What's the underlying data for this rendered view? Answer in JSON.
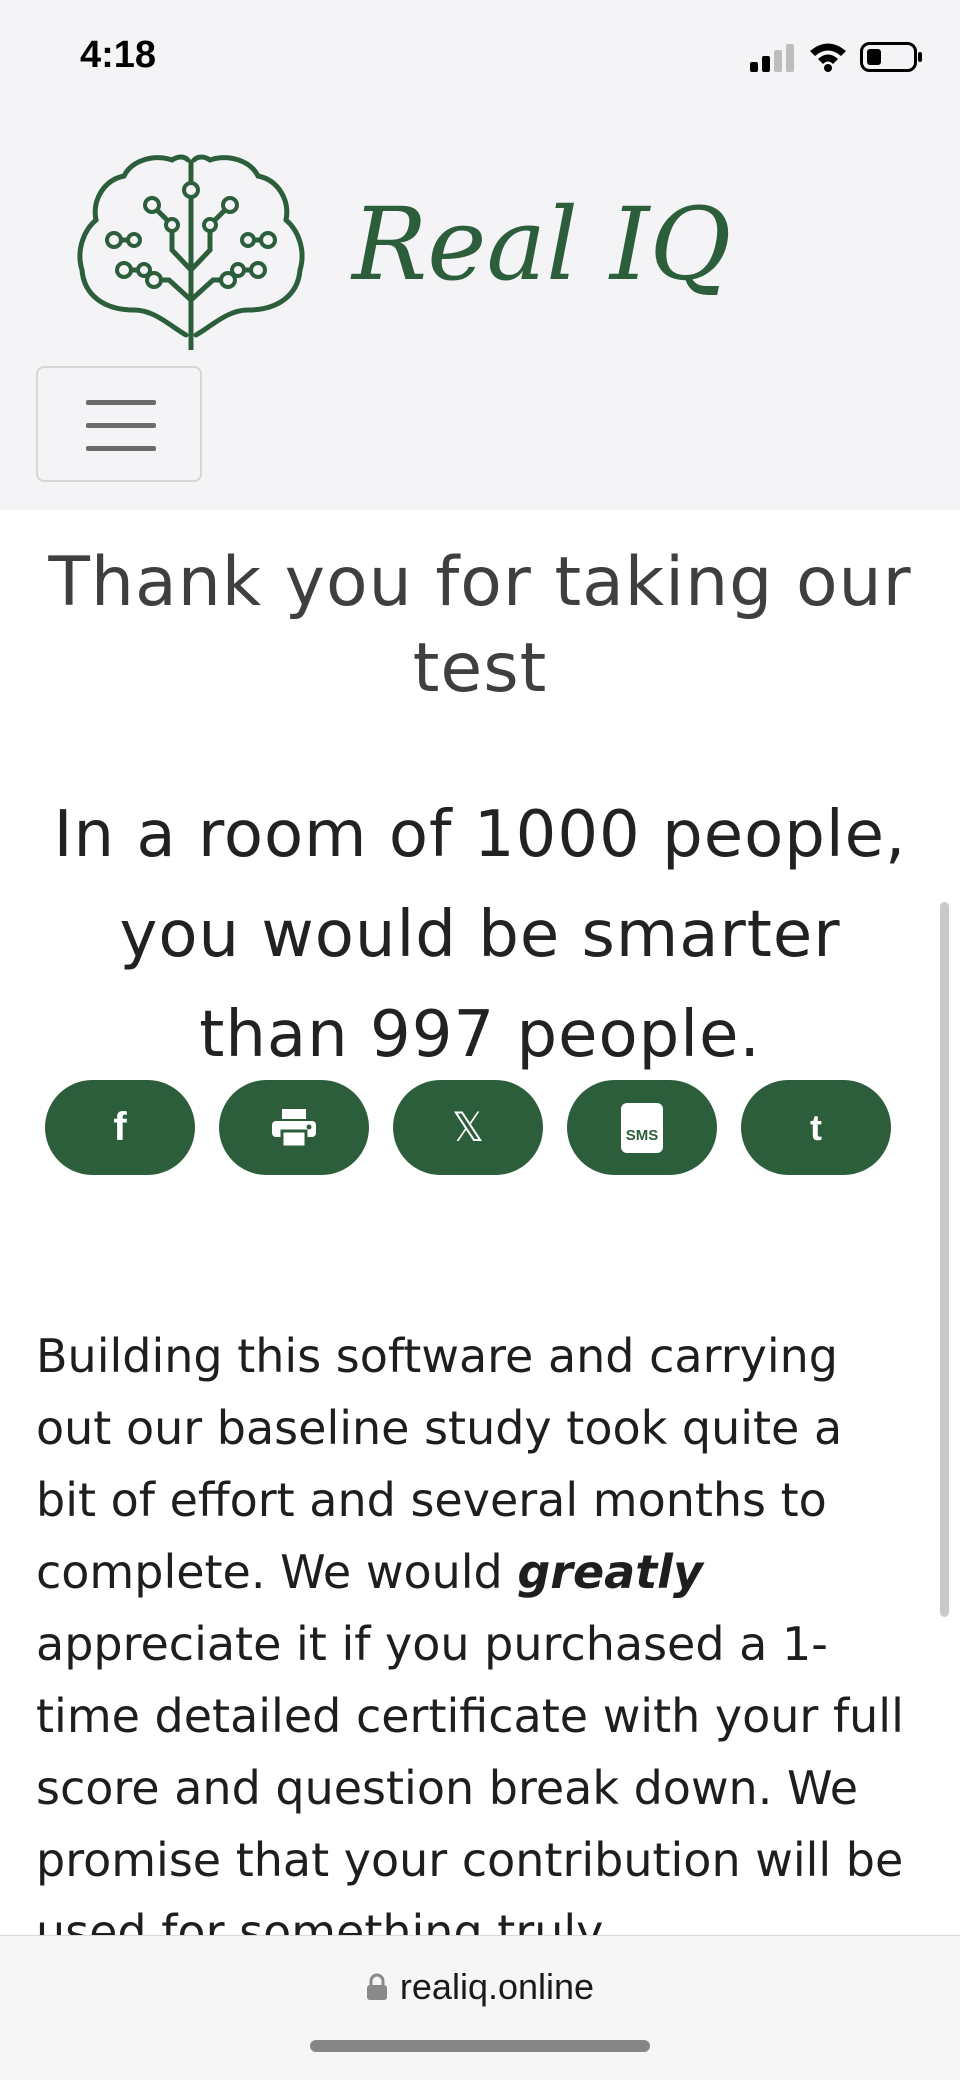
{
  "status_bar": {
    "time": "4:18"
  },
  "header": {
    "logo_text": "Real IQ",
    "menu_icon": "hamburger-menu-icon"
  },
  "main": {
    "title": "Thank you for taking our test",
    "result_line_1": "In a room of 1000 people,",
    "result_line_2": "you would be smarter",
    "result_line_3": "than 997 people.",
    "share_buttons": [
      {
        "icon": "facebook-icon",
        "label": "f"
      },
      {
        "icon": "printer-icon",
        "label": ""
      },
      {
        "icon": "x-icon",
        "label": "𝕏"
      },
      {
        "icon": "sms-icon",
        "label": "SMS"
      },
      {
        "icon": "tumblr-icon",
        "label": "t"
      }
    ],
    "body_before": "Building this software and carrying out our baseline study took quite a bit of effort and several months to complete. We would ",
    "body_emphasis": "greatly",
    "body_after": " appreciate it if you purchased a 1-time detailed certificate with your full score and question break down. We promise that your contribution will be used for something truly"
  },
  "browser": {
    "url": "realiq.online",
    "lock_icon": "lock-icon"
  },
  "colors": {
    "brand_green": "#2c5e3c",
    "header_bg": "#f4f4f6"
  }
}
